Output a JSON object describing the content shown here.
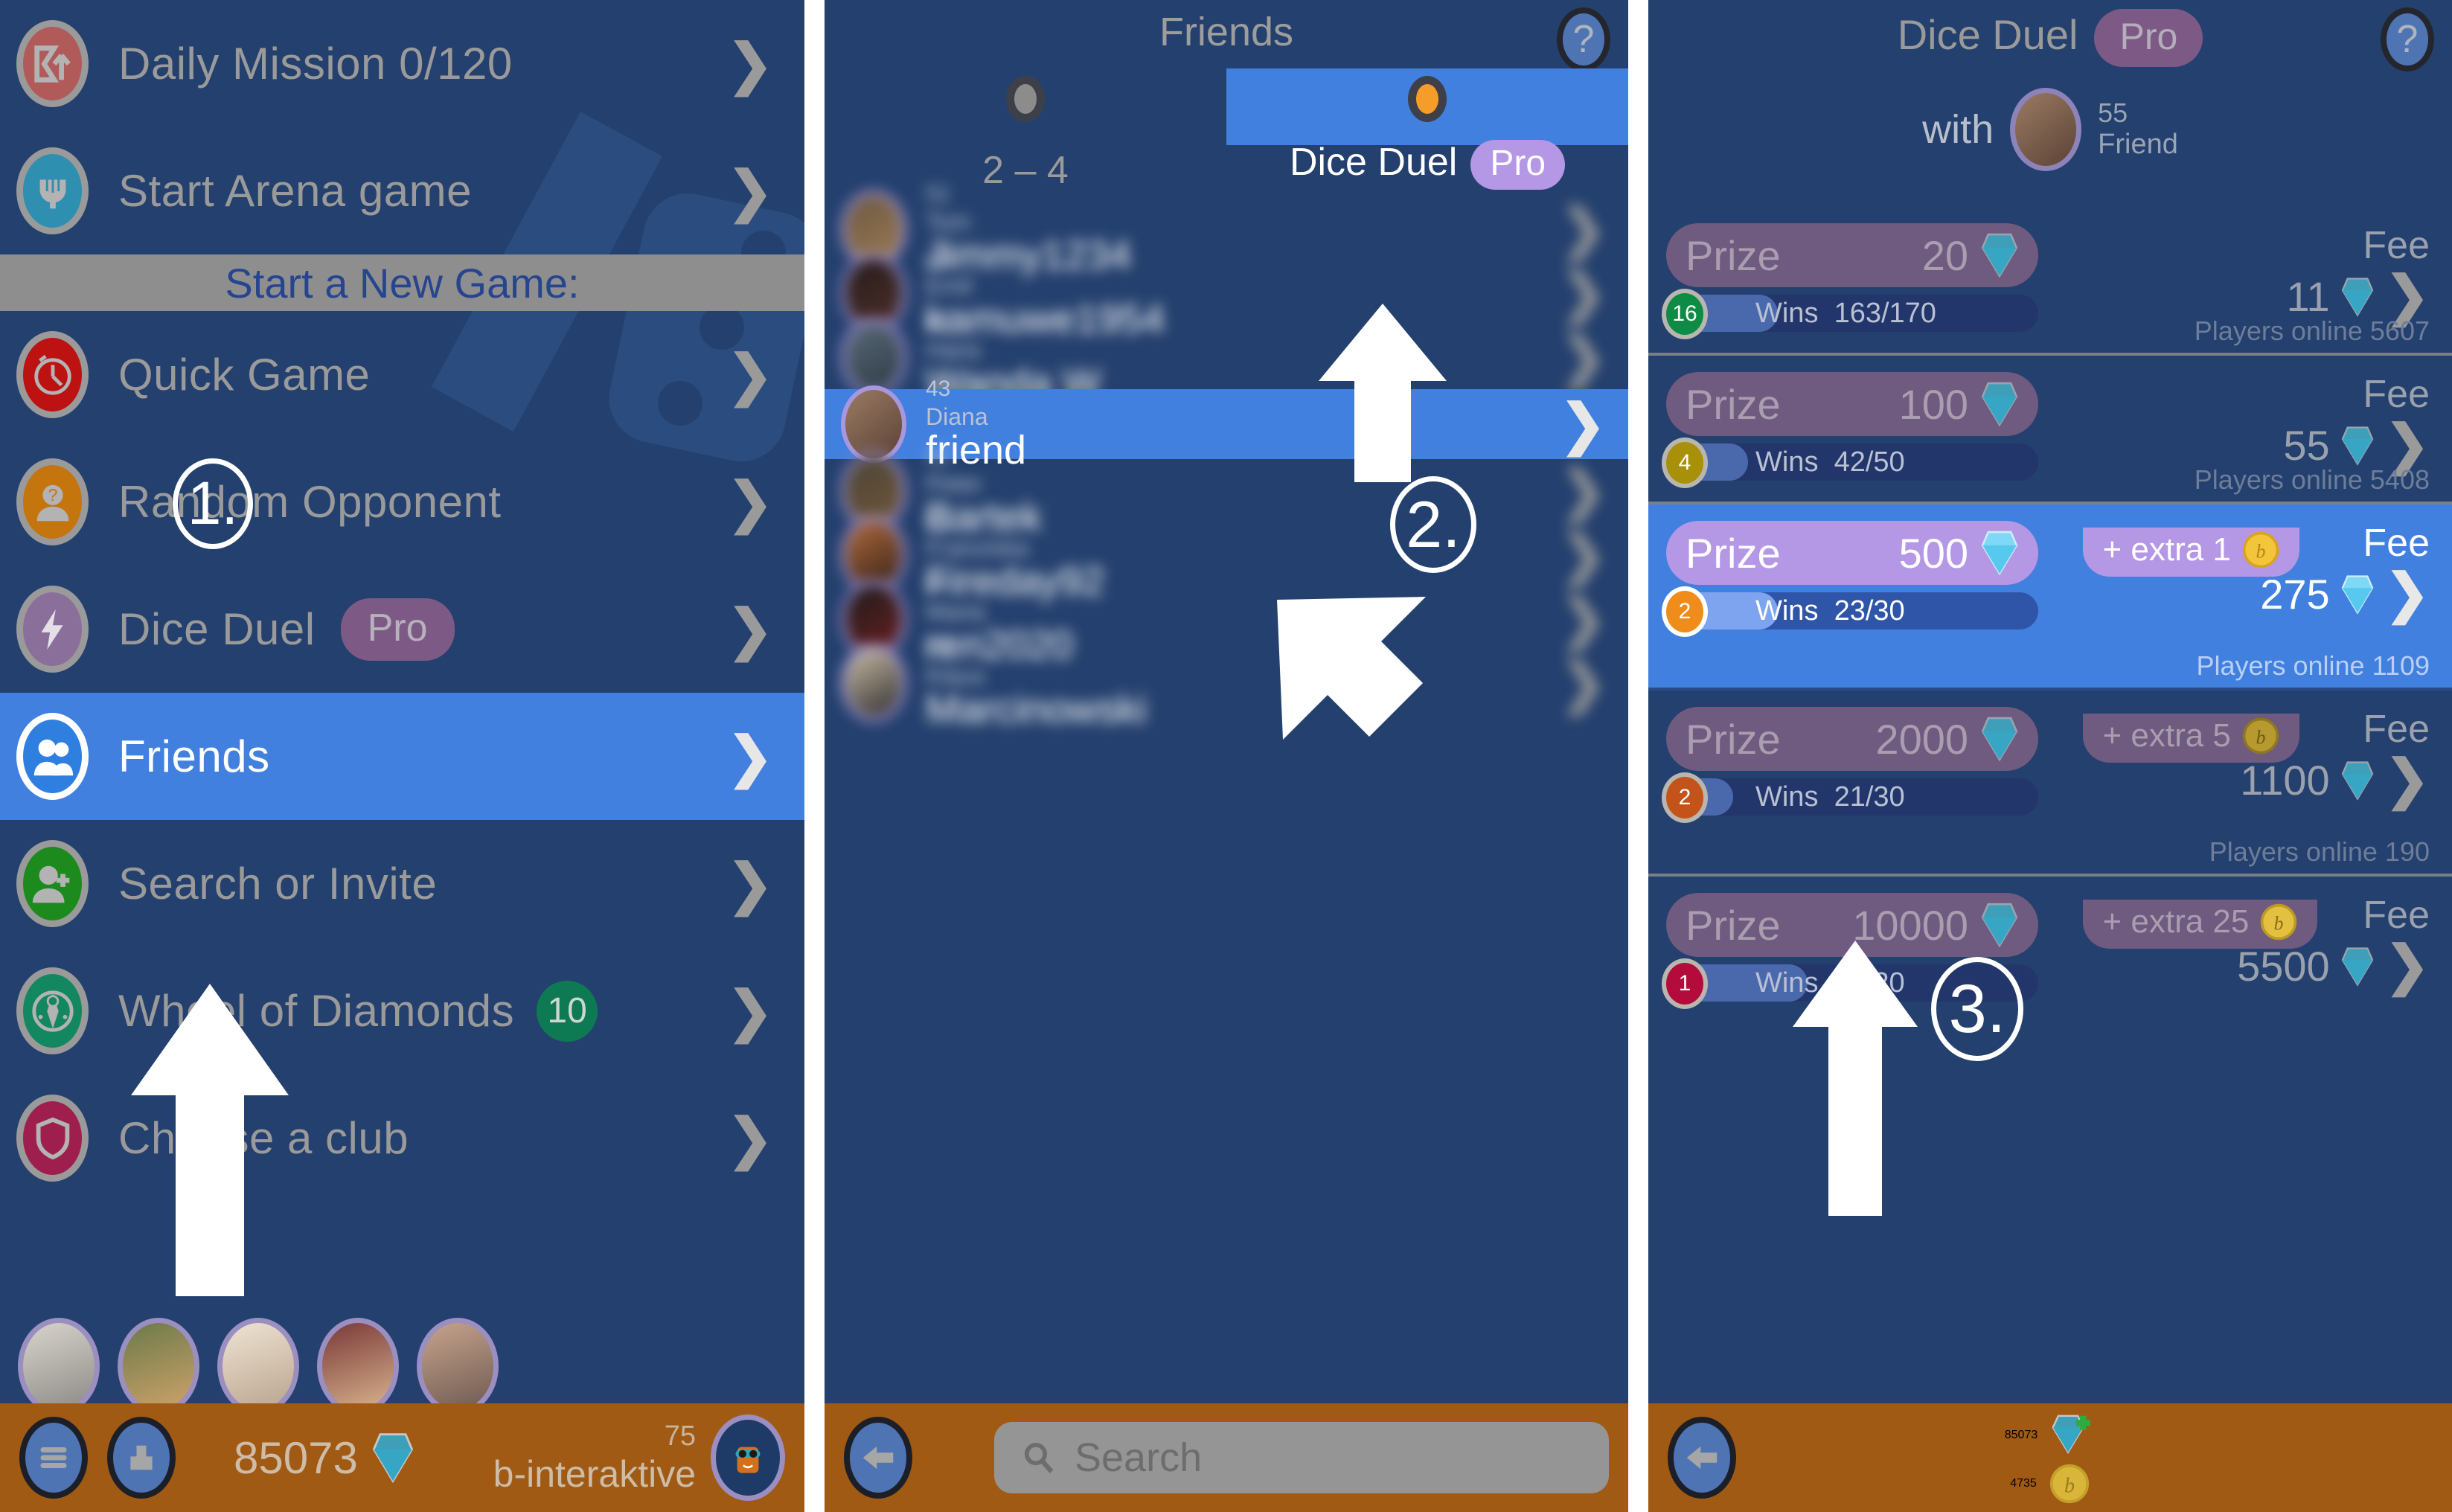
{
  "left_panel": {
    "menu_items": [
      {
        "label": "Daily Mission 0/120",
        "icon": "sigma-arrow-icon",
        "icon_color": "#b05a5a",
        "badge": null,
        "pro": false,
        "selected": false
      },
      {
        "label": "Start Arena game",
        "icon": "arena-icon",
        "icon_color": "#2f8fb0",
        "badge": null,
        "pro": false,
        "selected": false
      }
    ],
    "section_header": "Start a New Game:",
    "game_items": [
      {
        "label": "Quick Game",
        "icon": "stopwatch-icon",
        "icon_color": "#bc1212",
        "badge": null,
        "pro": false,
        "selected": false
      },
      {
        "label": "Random Opponent",
        "icon": "question-person-icon",
        "icon_color": "#c4750e",
        "badge": null,
        "pro": false,
        "selected": false
      },
      {
        "label": "Dice Duel",
        "icon": "lightning-icon",
        "icon_color": "#8a6f9b",
        "badge": null,
        "pro": true,
        "pro_label": "Pro",
        "selected": false
      },
      {
        "label": "Friends",
        "icon": "friends-icon",
        "icon_color": "#2f7fe0",
        "badge": null,
        "pro": false,
        "selected": true
      },
      {
        "label": "Search or Invite",
        "icon": "add-person-icon",
        "icon_color": "#1d8a1d",
        "badge": null,
        "pro": false,
        "selected": false
      },
      {
        "label": "Wheel of Diamonds",
        "icon": "wheel-icon",
        "icon_color": "#13875f",
        "badge": "10",
        "pro": false,
        "selected": false
      },
      {
        "label": "Choose a club",
        "icon": "shield-icon",
        "icon_color": "#9e1f4d",
        "badge": null,
        "pro": false,
        "selected": false
      }
    ],
    "bottom_bar": {
      "menu_button_icon": "hamburger-menu-icon",
      "thumb_button_icon": "thumbs-up-icon",
      "diamonds": "85073",
      "diamond_icon": "diamond-icon",
      "level": "75",
      "username": "b-interaktive",
      "avatar_icon": "mascot-avatar"
    }
  },
  "middle_panel": {
    "title": "Friends",
    "help_icon": "question-mark-icon",
    "modes": [
      {
        "label": "2 – 4",
        "selected": false,
        "dot_color": "#8c8c8c",
        "pro": false
      },
      {
        "label": "Dice Duel",
        "selected": true,
        "dot_color": "#f59c29",
        "pro": true,
        "pro_label": "Pro"
      }
    ],
    "friends": [
      {
        "level": "",
        "real_name": "",
        "name": "",
        "blurred": true,
        "selected": false
      },
      {
        "level": "",
        "real_name": "",
        "name": "",
        "blurred": true,
        "selected": false
      },
      {
        "level": "",
        "real_name": "",
        "name": "",
        "blurred": true,
        "selected": false
      },
      {
        "level": "43",
        "real_name": "Diana",
        "name": "friend",
        "blurred": false,
        "selected": true
      },
      {
        "level": "",
        "real_name": "",
        "name": "",
        "blurred": true,
        "selected": false
      },
      {
        "level": "",
        "real_name": "",
        "name": "",
        "blurred": true,
        "selected": false
      },
      {
        "level": "",
        "real_name": "",
        "name": "",
        "blurred": true,
        "selected": false
      },
      {
        "level": "",
        "real_name": "",
        "name": "",
        "blurred": true,
        "selected": false
      }
    ],
    "bottom_bar": {
      "back_icon": "back-arrow-icon",
      "search_placeholder": "Search",
      "search_value": "",
      "search_icon": "search-icon"
    }
  },
  "right_panel": {
    "title": "Dice Duel",
    "pro_label": "Pro",
    "help_icon": "question-mark-icon",
    "opponent": {
      "with_label": "with",
      "avatar_icon": "opponent-avatar",
      "level": "55",
      "relation": "Friend"
    },
    "prize_rows": [
      {
        "prize_label": "Prize",
        "prize_value": "20",
        "extra": null,
        "fee_label": "Fee",
        "fee_value": "11",
        "medal": "16",
        "medal_color": "#0e8b45",
        "wins_label": "Wins",
        "wins": "163/170",
        "wins_pct": 30,
        "players_online": "Players online 5607",
        "selected": false
      },
      {
        "prize_label": "Prize",
        "prize_value": "100",
        "extra": null,
        "fee_label": "Fee",
        "fee_value": "55",
        "medal": "4",
        "medal_color": "#a89008",
        "wins_label": "Wins",
        "wins": "42/50",
        "wins_pct": 22,
        "players_online": "Players online 5408",
        "selected": false
      },
      {
        "prize_label": "Prize",
        "prize_value": "500",
        "extra": "+ extra 1",
        "fee_label": "Fee",
        "fee_value": "275",
        "medal": "2",
        "medal_color": "#f08c1a",
        "wins_label": "Wins",
        "wins": "23/30",
        "wins_pct": 30,
        "players_online": "Players online 1109",
        "selected": true
      },
      {
        "prize_label": "Prize",
        "prize_value": "2000",
        "extra": "+ extra 5",
        "fee_label": "Fee",
        "fee_value": "1100",
        "medal": "2",
        "medal_color": "#c4531a",
        "wins_label": "Wins",
        "wins": "21/30",
        "wins_pct": 18,
        "players_online": "Players online 190",
        "selected": false
      },
      {
        "prize_label": "Prize",
        "prize_value": "10000",
        "extra": "+ extra 25",
        "fee_label": "Fee",
        "fee_value": "5500",
        "medal": "1",
        "medal_color": "#b20b3c",
        "wins_label": "Wins",
        "wins": "14/20",
        "wins_pct": 38,
        "players_online": "",
        "selected": false
      }
    ],
    "bottom_bar": {
      "back_icon": "back-arrow-icon",
      "diamonds": "85073",
      "diamond_plus_icon": "diamond-plus-icon",
      "coins": "4735",
      "coin_icon": "coin-icon"
    }
  },
  "annotations": {
    "step1": "1.",
    "step2": "2.",
    "step3": "3."
  },
  "colors": {
    "panel_bg": "#24406e",
    "selected_blue": "#4280e0",
    "bottom_orange": "#a05a14",
    "pro_purple": "#7d5a86",
    "accent_orange": "#f59c29",
    "muted_text": "#9a9a9a"
  }
}
